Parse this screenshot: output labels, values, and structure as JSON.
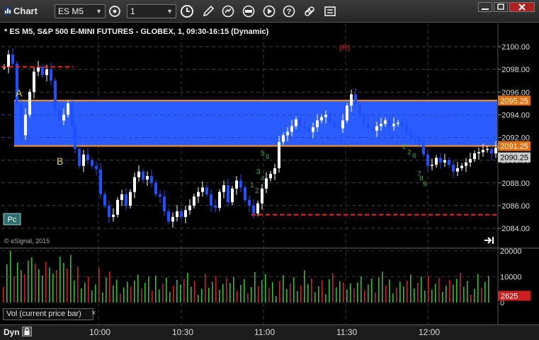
{
  "window": {
    "title": "Chart"
  },
  "toolbar": {
    "symbol": "ES M5",
    "interval": "1",
    "icons": [
      "settings-icon",
      "clock-icon",
      "pencil-icon",
      "refresh-icon",
      "studies-icon",
      "play-icon",
      "help-icon",
      "link-icon",
      "checklist-icon"
    ]
  },
  "chart": {
    "title": "* ES M5, S&P 500 E-MINI FUTURES - GLOBEX, 1, 09:30-16:15 (Dynamic)",
    "watermark": "© eSignal, 2015",
    "price_axis_labels": [
      "2100.00",
      "2098.00",
      "2096.00",
      "2094.00",
      "2092.00",
      "2090.00",
      "2088.00",
      "2086.00",
      "2084.00"
    ],
    "price_tags": [
      {
        "text": "2095.25",
        "color": "#e07010"
      },
      {
        "text": "2091.25",
        "color": "#e07010"
      },
      {
        "text": "2090.25",
        "color": "#cccccc"
      }
    ],
    "annotations": {
      "a": "A",
      "b": "B",
      "r": "(R)",
      "pc": "Pc"
    },
    "td_counts_up": [
      "5",
      "6",
      "3",
      "4",
      "1",
      "2"
    ],
    "td_counts_down": [
      "2",
      "2",
      "6",
      "7",
      "8",
      "9"
    ],
    "band_color": "#2b5cff",
    "band_line_color": "#ff9a1a",
    "level_line_color": "#ff2222",
    "up_candle_color": "#ffffff",
    "down_candle_color": "#1e50ff"
  },
  "volume": {
    "label": "Vol (current price bar)",
    "close_label": "×",
    "axis_labels": [
      "20000",
      "10000",
      "0"
    ],
    "current_value": "2625",
    "current_color": "#cc2020"
  },
  "time_axis": {
    "labels": [
      "10:00",
      "10:30",
      "11:00",
      "11:30",
      "12:00"
    ]
  },
  "status": {
    "mode": "Dyn"
  }
}
